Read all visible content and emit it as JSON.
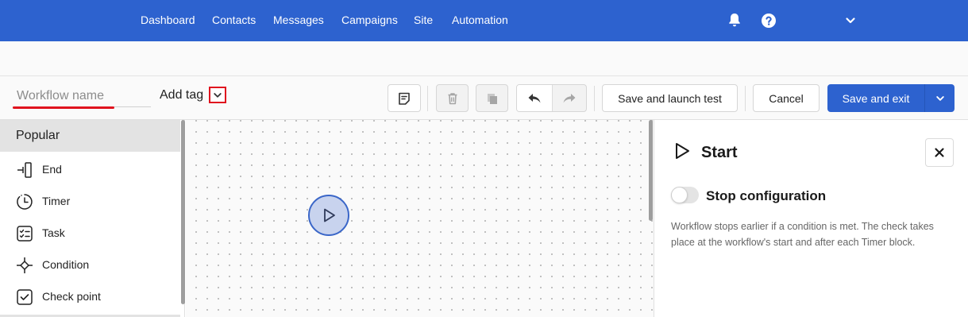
{
  "nav": {
    "items": [
      "Dashboard",
      "Contacts",
      "Messages",
      "Campaigns",
      "Site",
      "Automation"
    ],
    "icons": [
      "bell-icon",
      "help-icon",
      "chevron-down-icon"
    ]
  },
  "toolbar": {
    "workflow_name_placeholder": "Workflow name",
    "add_tag_label": "Add tag",
    "save_launch_test_label": "Save and launch test",
    "cancel_label": "Cancel",
    "save_exit_label": "Save and exit",
    "icons": [
      "note-icon",
      "trash-icon",
      "copy-icon",
      "undo-icon",
      "redo-icon"
    ]
  },
  "palette": {
    "header": "Popular",
    "items": [
      {
        "label": "End",
        "icon": "end-icon"
      },
      {
        "label": "Timer",
        "icon": "timer-icon"
      },
      {
        "label": "Task",
        "icon": "task-icon"
      },
      {
        "label": "Condition",
        "icon": "condition-icon"
      },
      {
        "label": "Check point",
        "icon": "check-point-icon"
      }
    ]
  },
  "panel": {
    "title": "Start",
    "toggle_label": "Stop configuration",
    "toggle_on": false,
    "description": "Workflow stops earlier if a condition is met. The check takes place at the workflow's start and after each Timer block."
  },
  "colors": {
    "brand": "#2d62cf",
    "highlight": "#e0131e",
    "node_fill": "#c8d3ee"
  }
}
